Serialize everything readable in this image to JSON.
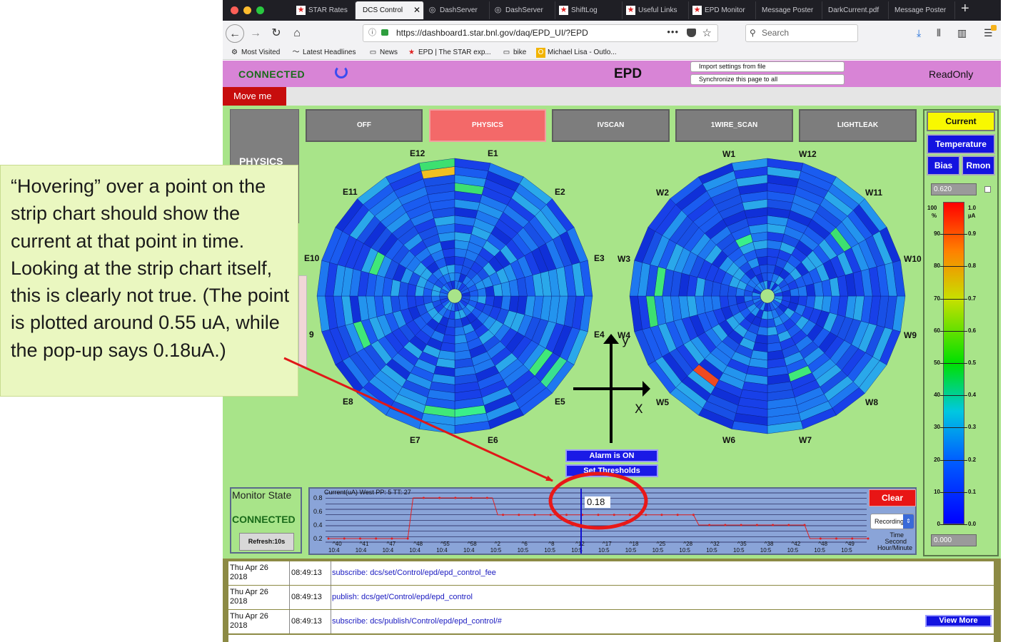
{
  "browser": {
    "tabs": [
      {
        "label": "STAR Rates",
        "icon": "star-favicon"
      },
      {
        "label": "DCS Control",
        "icon": "none",
        "active": true
      },
      {
        "label": "DashServer",
        "icon": "globe-favicon"
      },
      {
        "label": "DashServer",
        "icon": "globe-favicon"
      },
      {
        "label": "ShiftLog",
        "icon": "star-favicon"
      },
      {
        "label": "Useful Links",
        "icon": "star-favicon"
      },
      {
        "label": "EPD Monitor",
        "icon": "star-favicon"
      },
      {
        "label": "Message Poster",
        "icon": "none"
      },
      {
        "label": "DarkCurrent.pdf",
        "icon": "none"
      },
      {
        "label": "Message Poster",
        "icon": "none"
      }
    ],
    "url": "https://dashboard1.star.bnl.gov/daq/EPD_UI/?EPD",
    "search_placeholder": "Search",
    "bookmarks": [
      {
        "label": "Most Visited",
        "icon": "gear-icon"
      },
      {
        "label": "Latest Headlines",
        "icon": "rss-icon"
      },
      {
        "label": "News",
        "icon": "folder-icon"
      },
      {
        "label": "EPD | The STAR exp...",
        "icon": "star-favicon"
      },
      {
        "label": "bike",
        "icon": "folder-icon"
      },
      {
        "label": "Michael Lisa - Outlo...",
        "icon": "outlook-icon"
      }
    ]
  },
  "header": {
    "status": "CONNECTED",
    "title": "EPD",
    "import_btn": "Import settings from file",
    "sync_btn": "Synchronize this page to all",
    "mode_label": "ReadOnly"
  },
  "move_me": "Move me",
  "side_state": "PHYSICS",
  "modes": [
    "OFF",
    "PHYSICS",
    "IVSCAN",
    "1WIRE_SCAN",
    "LIGHTLEAK"
  ],
  "active_mode": "PHYSICS",
  "east_sectors": [
    "E1",
    "E2",
    "E3",
    "E4",
    "E5",
    "E6",
    "E7",
    "E8",
    "9",
    "E10",
    "E11",
    "E12"
  ],
  "west_sectors": [
    "W1",
    "W2",
    "W3",
    "W4",
    "W5",
    "W6",
    "W7",
    "W8",
    "W9",
    "W10",
    "W11",
    "W12"
  ],
  "axes": {
    "x": "X",
    "y": "y"
  },
  "alarm": "Alarm is ON",
  "thresholds": "Set Thresholds",
  "right_panel": {
    "current": "Current",
    "temperature": "Temperature",
    "bias": "Bias",
    "rmon": "Rmon",
    "max": "0.620",
    "min": "0.000",
    "left_unit_top": "100",
    "left_unit": "%",
    "right_unit_top": "1.0",
    "right_unit": "µA",
    "left_ticks": [
      "90",
      "80",
      "70",
      "60",
      "50",
      "40",
      "30",
      "20",
      "10",
      "0"
    ],
    "right_ticks": [
      "0.9",
      "0.8",
      "0.7",
      "0.6",
      "0.5",
      "0.4",
      "0.3",
      "0.2",
      "0.1",
      "0.0"
    ]
  },
  "monitor": {
    "title": "Monitor State",
    "status": "CONNECTED",
    "refresh": "Refresh:10s"
  },
  "strip": {
    "title": "Current(uA) West PP: 5 TT: 27",
    "clear": "Clear",
    "record": "Recording",
    "tooltip": "0.18",
    "time_label": "Time",
    "second_label": "Second",
    "hm_label": "Hour/Minute",
    "y_ticks": [
      "0.8",
      "0.6",
      "0.4",
      "0.2"
    ],
    "x_ticks": [
      {
        "s": "40",
        "hm": "10:4"
      },
      {
        "s": "41",
        "hm": "10:4"
      },
      {
        "s": "47",
        "hm": "10:4"
      },
      {
        "s": "48",
        "hm": "10:4"
      },
      {
        "s": "55",
        "hm": "10:4"
      },
      {
        "s": "58",
        "hm": "10:4"
      },
      {
        "s": "2",
        "hm": "10:5"
      },
      {
        "s": "6",
        "hm": "10:5"
      },
      {
        "s": "8",
        "hm": "10:5"
      },
      {
        "s": "12",
        "hm": "10:5"
      },
      {
        "s": "17",
        "hm": "10:5"
      },
      {
        "s": "18",
        "hm": "10:5"
      },
      {
        "s": "25",
        "hm": "10:5"
      },
      {
        "s": "28",
        "hm": "10:5"
      },
      {
        "s": "32",
        "hm": "10:5"
      },
      {
        "s": "35",
        "hm": "10:5"
      },
      {
        "s": "38",
        "hm": "10:5"
      },
      {
        "s": "42",
        "hm": "10:5"
      },
      {
        "s": "48",
        "hm": "10:5"
      },
      {
        "s": "49",
        "hm": "10:5"
      }
    ],
    "series_color": "#e02020"
  },
  "log": [
    {
      "date1": "Thu Apr 26",
      "date2": "2018",
      "time": "08:49:13",
      "msg": "subscribe: dcs/set/Control/epd/epd_control_fee"
    },
    {
      "date1": "Thu Apr 26",
      "date2": "2018",
      "time": "08:49:13",
      "msg": "publish: dcs/get/Control/epd/epd_control"
    },
    {
      "date1": "Thu Apr 26",
      "date2": "2018",
      "time": "08:49:13",
      "msg": "subscribe: dcs/publish/Control/epd/epd_control/#"
    }
  ],
  "view_more": "View More",
  "annotation": "“Hovering” over a point on the strip chart should show the current at that point in time.  Looking at the strip chart itself, this is clearly not true.  (The point is plotted around 0.55 uA, while the pop-up says 0.18uA.)"
}
